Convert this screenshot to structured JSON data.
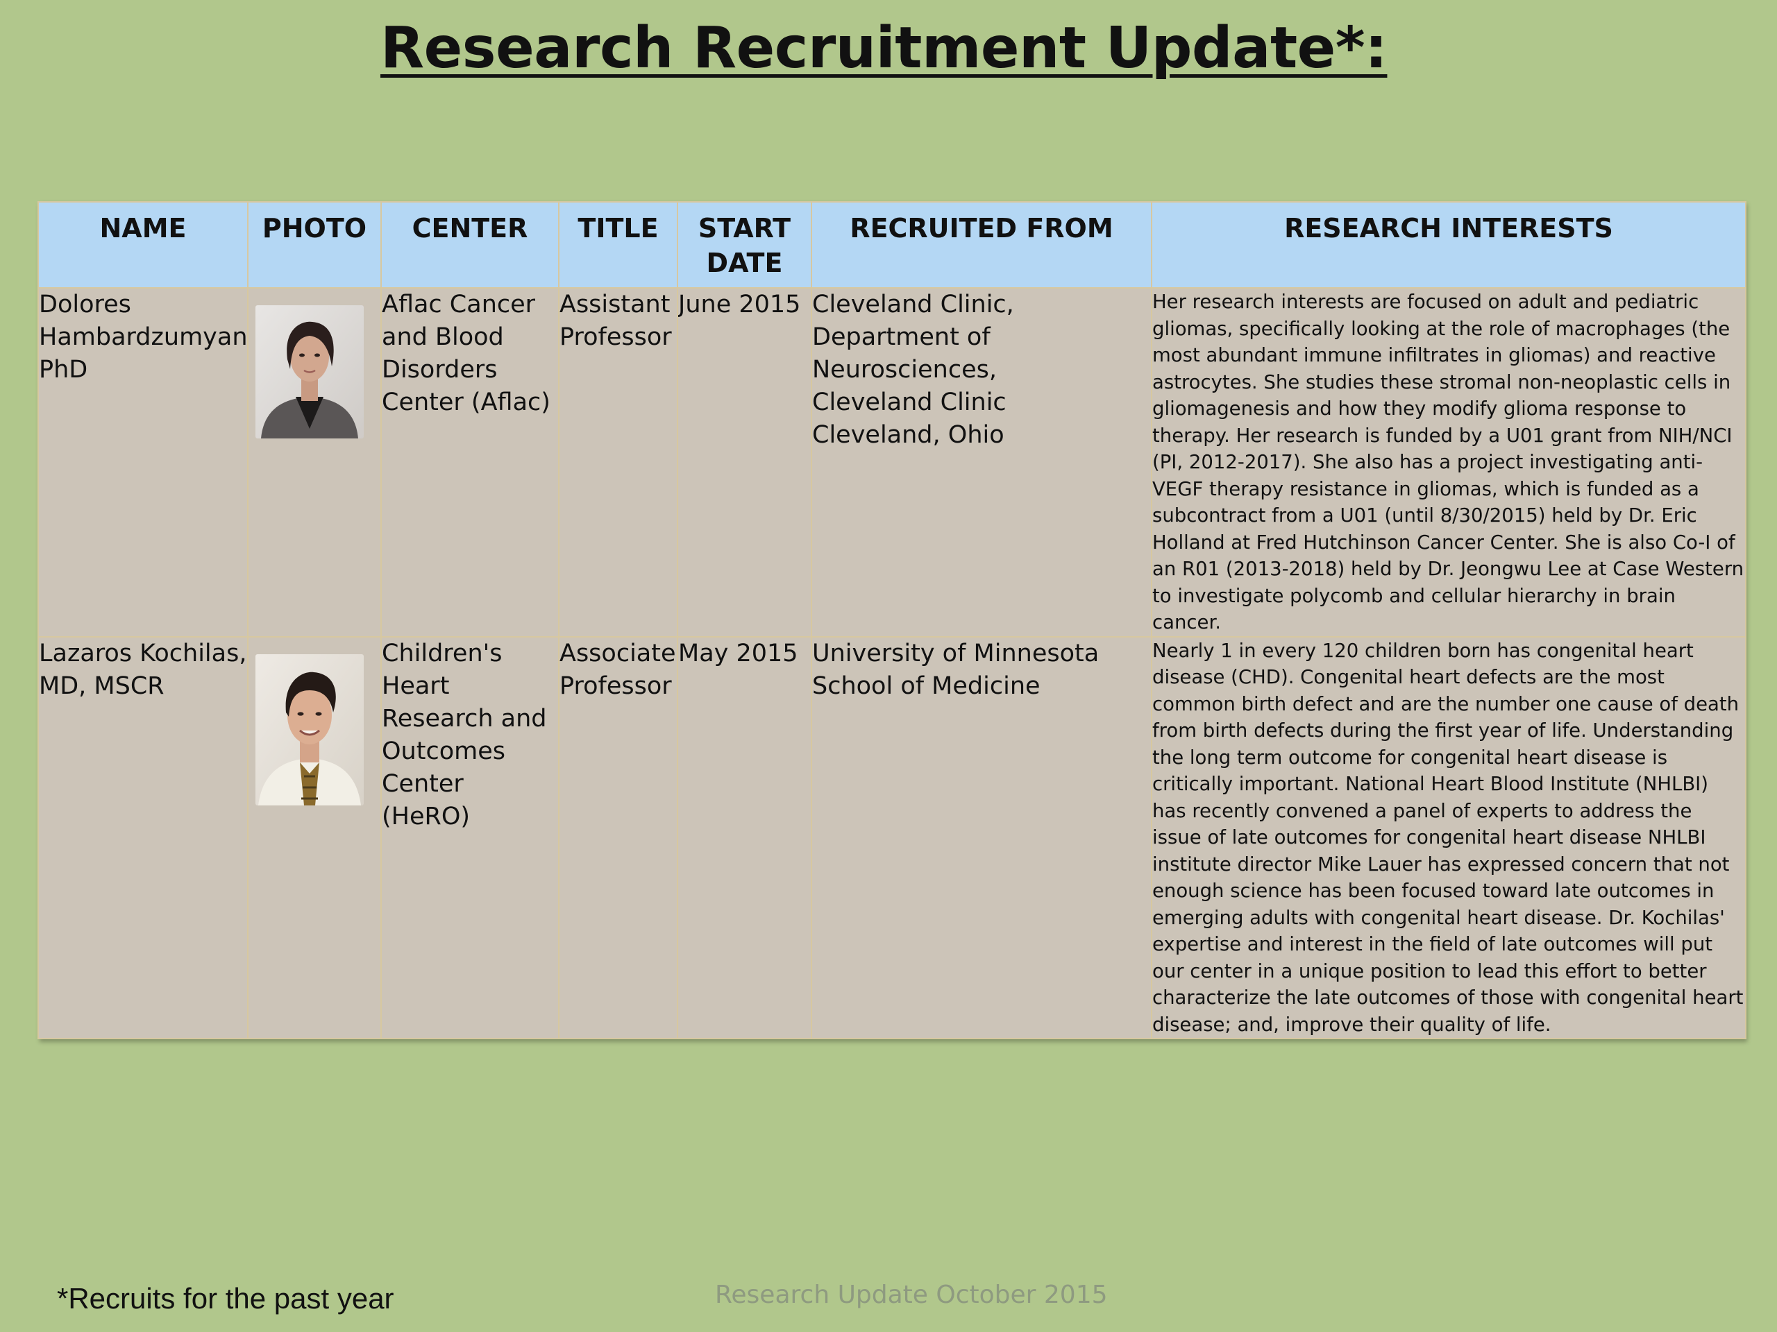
{
  "title": "Research Recruitment Update*:",
  "table": {
    "headers": {
      "name": "NAME",
      "photo": "PHOTO",
      "center": "CENTER",
      "title": "TITLE",
      "start_date_line1": "START",
      "start_date_line2": "DATE",
      "recruited_from": "RECRUITED FROM",
      "research_interests": "RESEARCH INTERESTS"
    },
    "rows": [
      {
        "name": "Dolores Hambardzumyan, PhD",
        "center": "Aflac Cancer and Blood Disorders Center (Aflac)",
        "title": "Assistant Professor",
        "start_date": "June 2015",
        "recruited_from_lines": [
          "Cleveland Clinic,",
          "Department of Neurosciences,",
          "Cleveland Clinic",
          "Cleveland, Ohio"
        ],
        "research_interests": "Her research interests are focused on adult and pediatric gliomas, specifically looking at the role of macrophages (the most abundant immune infiltrates in gliomas) and reactive astrocytes. She studies these stromal non-neoplastic cells in gliomagenesis and how they modify glioma response to therapy. Her research is funded by a U01 grant from NIH/NCI (PI, 2012-2017). She also has a project investigating anti-VEGF therapy resistance in gliomas, which is funded as a subcontract from a U01 (until 8/30/2015) held by Dr. Eric Holland at Fred Hutchinson Cancer Center. She is also Co-I of an R01 (2013-2018) held by Dr. Jeongwu Lee at Case Western to investigate polycomb and cellular hierarchy in brain cancer."
      },
      {
        "name": "Lazaros Kochilas, MD, MSCR",
        "center": "Children's Heart Research and Outcomes Center (HeRO)",
        "title": "Associate Professor",
        "start_date": "May 2015",
        "recruited_from_lines": [
          "University of Minnesota",
          "School of Medicine"
        ],
        "research_interests": "Nearly 1 in every 120 children born has congenital heart disease (CHD). Congenital heart defects are the most common birth defect and are the number one cause of death from birth defects during the first year of life. Understanding the long term outcome for congenital heart disease is critically important. National Heart Blood Institute (NHLBI) has recently convened a panel of experts to address the issue of late outcomes for congenital heart disease NHLBI institute director Mike Lauer has expressed concern that not enough science has been focused toward late outcomes in emerging adults with congenital heart disease. Dr. Kochilas' expertise and interest in the field of late outcomes will put our center in a unique position to lead this effort to better characterize the late outcomes of those with congenital heart disease; and, improve their quality of life."
      }
    ]
  },
  "footnote": "*Recruits for the past year",
  "footer": "Research Update October 2015",
  "colors": {
    "background": "#b1c78c",
    "header_fill": "#b4d7f4",
    "row_fill": "#ccc4b8",
    "footer_text": "#8e9a80"
  }
}
